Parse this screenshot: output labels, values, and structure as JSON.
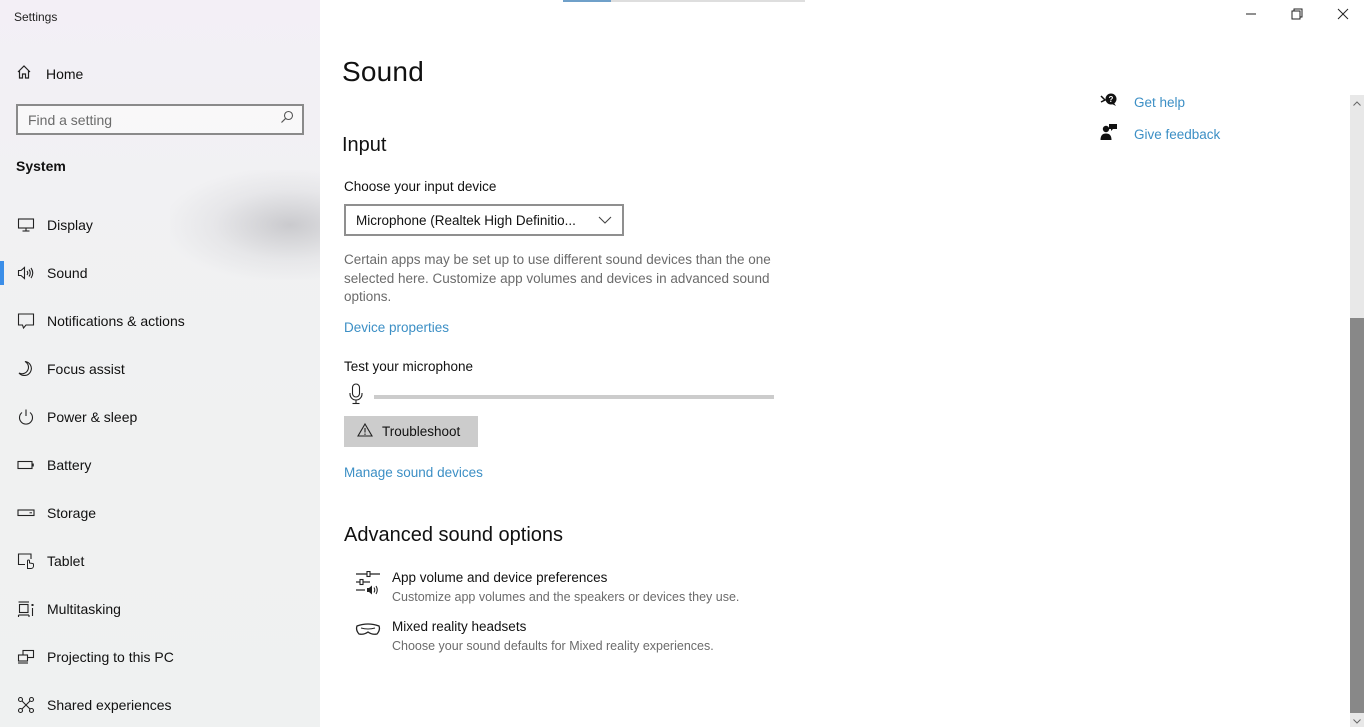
{
  "window": {
    "title": "Settings",
    "controls": {
      "minimize": "minimize-icon",
      "restore": "restore-icon",
      "close": "close-icon"
    }
  },
  "sidebar": {
    "home_label": "Home",
    "search_placeholder": "Find a setting",
    "section_label": "System",
    "items": [
      {
        "label": "Display",
        "icon": "display-icon",
        "active": false
      },
      {
        "label": "Sound",
        "icon": "speaker-icon",
        "active": true
      },
      {
        "label": "Notifications & actions",
        "icon": "notification-icon",
        "active": false
      },
      {
        "label": "Focus assist",
        "icon": "moon-icon",
        "active": false
      },
      {
        "label": "Power & sleep",
        "icon": "power-icon",
        "active": false
      },
      {
        "label": "Battery",
        "icon": "battery-icon",
        "active": false
      },
      {
        "label": "Storage",
        "icon": "storage-icon",
        "active": false
      },
      {
        "label": "Tablet",
        "icon": "tablet-icon",
        "active": false
      },
      {
        "label": "Multitasking",
        "icon": "multitasking-icon",
        "active": false
      },
      {
        "label": "Projecting to this PC",
        "icon": "projecting-icon",
        "active": false
      },
      {
        "label": "Shared experiences",
        "icon": "shared-experiences-icon",
        "active": false
      }
    ],
    "accent_color": "#3b8ee8"
  },
  "main": {
    "page_title": "Sound",
    "top_volume_partial": 0.2,
    "input": {
      "heading": "Input",
      "device_label": "Choose your input device",
      "device_value": "Microphone (Realtek High Definitio...",
      "description": "Certain apps may be set up to use different sound devices than the one selected here. Customize app volumes and devices in advanced sound options.",
      "device_properties_link": "Device properties",
      "test_label": "Test your microphone",
      "mic_level": 0,
      "troubleshoot_label": "Troubleshoot",
      "manage_link": "Manage sound devices"
    },
    "advanced": {
      "heading": "Advanced sound options",
      "items": [
        {
          "title": "App volume and device preferences",
          "subtitle": "Customize app volumes and the speakers or devices they use.",
          "icon": "app-volume-icon"
        },
        {
          "title": "Mixed reality headsets",
          "subtitle": "Choose your sound defaults for Mixed reality experiences.",
          "icon": "headset-icon"
        }
      ]
    },
    "help": {
      "get_help": "Get help",
      "give_feedback": "Give feedback"
    },
    "link_color": "#3c8fc5"
  }
}
